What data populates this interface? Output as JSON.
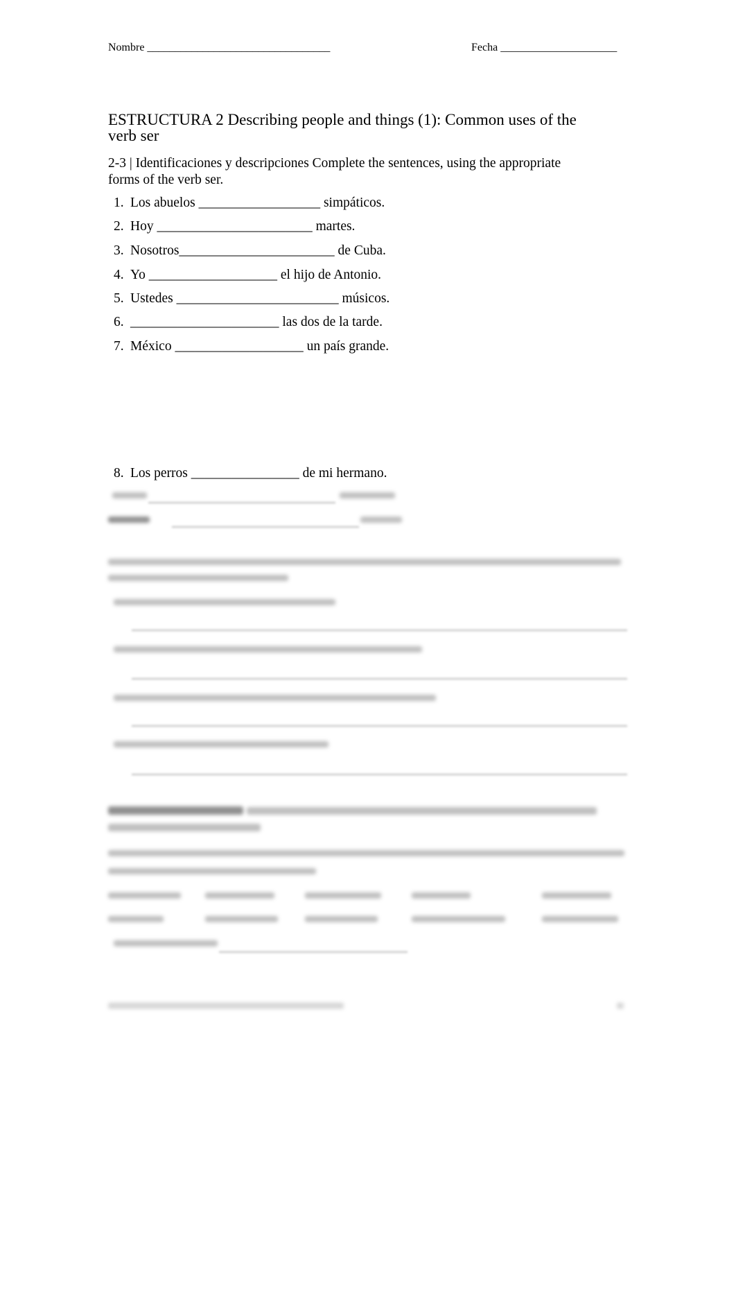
{
  "header": {
    "name_label": "Nombre _________________________________",
    "date_label": "Fecha _____________________"
  },
  "section": {
    "title_line1": "ESTRUCTURA 2    Describing people and things (1): Common uses of the",
    "title_line2": "verb  ser"
  },
  "exercise": {
    "instructions_line1": "2-3 | Identificaciones y descripciones     Complete the sentences, using the appropriate",
    "instructions_line2": "forms of the verb ser.",
    "items": [
      {
        "number": "1.",
        "text": "Los abuelos __________________ simpáticos."
      },
      {
        "number": "2.",
        "text": "Hoy _______________________ martes."
      },
      {
        "number": "3.",
        "text": "Nosotros_______________________ de Cuba."
      },
      {
        "number": "4.",
        "text": "Yo ___________________ el hijo de Antonio."
      },
      {
        "number": "5.",
        "text": "Ustedes ________________________ músicos."
      },
      {
        "number": "6.",
        "text": " ______________________ las dos de la tarde."
      },
      {
        "number": "7.",
        "text": "México ___________________ un país grande."
      },
      {
        "number": "8.",
        "text": "Los perros ________________ de mi hermano."
      }
    ]
  }
}
